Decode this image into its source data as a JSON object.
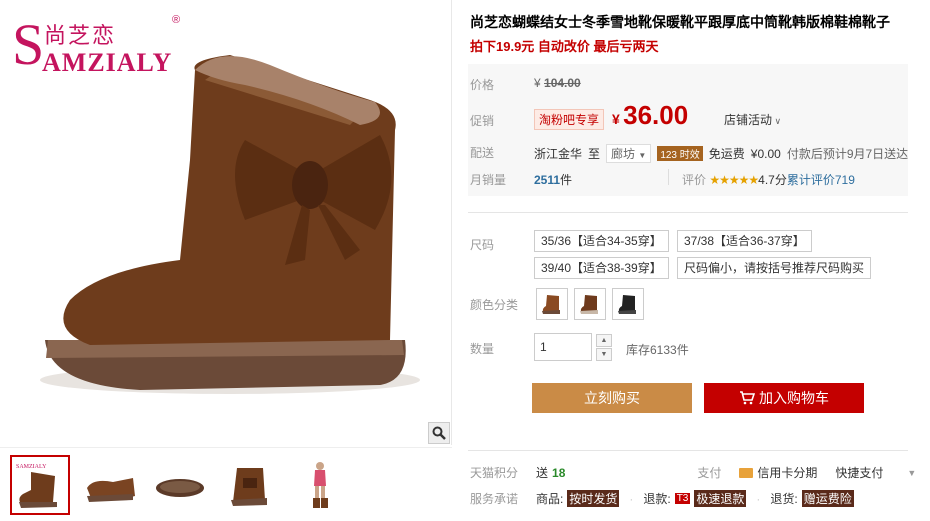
{
  "brand": {
    "cn": "尚芝恋",
    "en_initial": "S",
    "en_rest": "AMZIALY",
    "reg": "®"
  },
  "product": {
    "title": "尚芝恋蝴蝶结女士冬季雪地靴保暖靴平跟厚底中筒靴韩版棉鞋棉靴子",
    "promo": "拍下19.9元 自动改价 最后亏两天"
  },
  "price": {
    "label": "价格",
    "orig_yen": "¥",
    "orig_value": "104.00",
    "promo_label": "促销",
    "promo_tag": "淘粉吧专享",
    "now_yen": "¥",
    "now_value": "36.00",
    "store_activity": "店铺活动"
  },
  "shipping": {
    "label": "配送",
    "from": "浙江金华",
    "to_word": "至",
    "to_city": "廊坊",
    "badge": "123 时效",
    "free": "免运费",
    "fee": "¥0.00",
    "eta": "付款后预计9月7日送达"
  },
  "sales": {
    "label": "月销量",
    "count": "2511",
    "unit": "件",
    "review_label": "评价",
    "stars": "★★★★★",
    "rating": "4.7分",
    "total": "累计评价719"
  },
  "sizes": {
    "label": "尺码",
    "options": [
      "35/36【适合34-35穿】",
      "37/38【适合36-37穿】",
      "39/40【适合38-39穿】",
      "尺码偏小，请按括号推荐尺码购买"
    ]
  },
  "colors": {
    "label": "颜色分类",
    "swatches": [
      "#8a4a22",
      "#6e3a1c",
      "#222222"
    ]
  },
  "quantity": {
    "label": "数量",
    "value": "1",
    "stock": "库存6133件"
  },
  "actions": {
    "buy": "立刻购买",
    "cart": "加入购物车"
  },
  "bottom": {
    "points_label": "天猫积分",
    "points": "送",
    "points_num": "18",
    "pay_label": "支付",
    "pay_card": "信用卡分期",
    "pay_fast": "快捷支付",
    "service_label": "服务承诺",
    "goods": "商品:",
    "goods_tag": "按时发货",
    "refund": "退款:",
    "refund_t3": "T3",
    "refund_tag": "极速退款",
    "return": "退货:",
    "return_tag": "赠运费险"
  }
}
